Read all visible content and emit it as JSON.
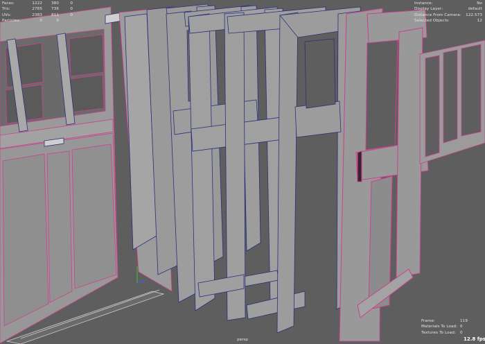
{
  "viewport": {
    "camera": "persp",
    "fps": "12.8 fps"
  },
  "poly_count": [
    {
      "label": "Faces:",
      "v1": "1222",
      "v2": "380",
      "v3": "0"
    },
    {
      "label": "Tris:",
      "v1": "2785",
      "v2": "736",
      "v3": "0"
    },
    {
      "label": "UVs:",
      "v1": "2383",
      "v2": "811",
      "v3": "0"
    },
    {
      "label": "Particles:",
      "v1": "0",
      "v2": "0",
      "v3": ""
    }
  ],
  "object_details": [
    {
      "label": "Instance:",
      "value": "No"
    },
    {
      "label": "Display Layer:",
      "value": "default"
    },
    {
      "label": "Distance From Camera:",
      "value": "122.573"
    },
    {
      "label": "Selected Objects:",
      "value": "12"
    }
  ],
  "scene_info": [
    {
      "label": "Frame:",
      "value": "119"
    },
    {
      "label": "Materials To Load:",
      "value": "0"
    },
    {
      "label": "Textures To Load:",
      "value": "0"
    }
  ],
  "colors": {
    "background": "#5e5e5e",
    "face": "#9a9a9a",
    "wire_selected": "#cf3f8f",
    "wire_blue": "#2a2f7a",
    "hud_text": "#e6e6e6"
  }
}
